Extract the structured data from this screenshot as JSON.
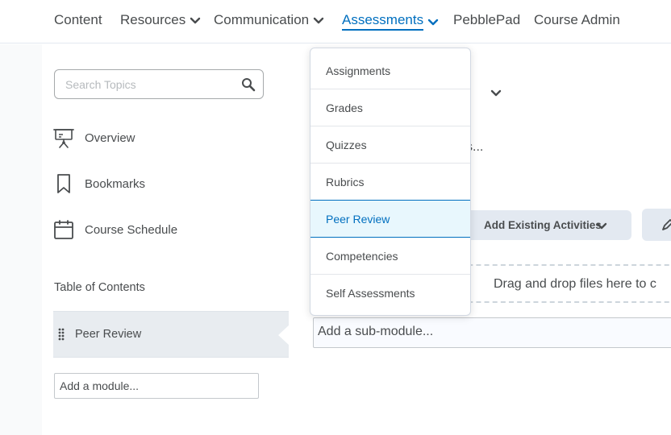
{
  "nav": {
    "items": [
      {
        "label": "Content",
        "has_menu": false
      },
      {
        "label": "Resources",
        "has_menu": true
      },
      {
        "label": "Communication",
        "has_menu": true
      },
      {
        "label": "Assessments",
        "has_menu": true,
        "active": true
      },
      {
        "label": "PebblePad",
        "has_menu": false
      },
      {
        "label": "Course Admin",
        "has_menu": false
      }
    ]
  },
  "search": {
    "placeholder": "Search Topics",
    "icon": "magnifier-icon"
  },
  "sidebar": {
    "links": [
      {
        "label": "Overview",
        "icon": "presentation-icon"
      },
      {
        "label": "Bookmarks",
        "icon": "bookmark-icon"
      },
      {
        "label": "Course Schedule",
        "icon": "calendar-icon"
      }
    ],
    "toc_label": "Table of Contents",
    "module": {
      "label": "Peer Review"
    },
    "add_module": "Add a module..."
  },
  "dropdown": {
    "items": [
      "Assignments",
      "Grades",
      "Quizzes",
      "Rubrics",
      "Peer Review",
      "Competencies",
      "Self Assessments"
    ],
    "selected": "Peer Review"
  },
  "main": {
    "partial_text": "s...",
    "add_existing_label": "Add Existing Activities",
    "dropzone_text": "Drag and drop files here to c",
    "add_submodule": "Add a sub-module..."
  },
  "colors": {
    "accent": "#006fbf",
    "text": "#494c4e",
    "selected_bg": "#e8f7fd",
    "button_bg": "#e3e9f1"
  }
}
